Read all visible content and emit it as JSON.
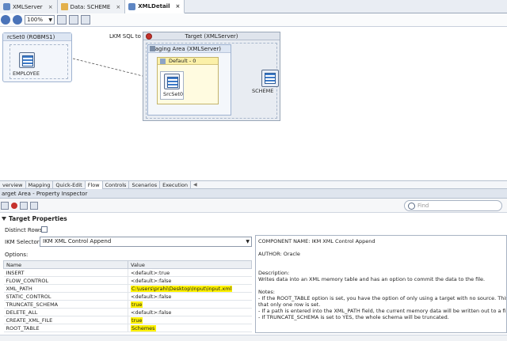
{
  "tabs": [
    {
      "label": "XMLServer",
      "active": false
    },
    {
      "label": "Data: SCHEME",
      "active": false
    },
    {
      "label": "XMLDetail",
      "active": true
    }
  ],
  "toolbar": {
    "zoom": "100%"
  },
  "canvas": {
    "source_set": "rcSet0 (ROBMS1)",
    "source_table": "EMPLOYEE",
    "lkm_label": "LKM SQL to SQ",
    "target_title": "Target (XMLServer)",
    "staging_title": "taging Area (XMLServer)",
    "default_title": "Default - 0",
    "srcset_label": "SrcSet0",
    "target_table": "SCHEME"
  },
  "editor_tabs": [
    "verview",
    "Mapping",
    "Quick-Edit",
    "Flow",
    "Controls",
    "Scenarios",
    "Execution"
  ],
  "active_editor_tab": "Flow",
  "inspector": {
    "title": "arget Area - Property Inspector",
    "find_placeholder": "Find",
    "section": "Target Properties",
    "distinct_rows_label": "Distinct Rows:",
    "ikm_label": "IKM Selector:",
    "ikm_value": "IKM XML Control Append",
    "options_label": "Options:",
    "columns": [
      "Name",
      "Value"
    ],
    "options": [
      {
        "name": "INSERT",
        "value": "<default>:true",
        "highlight": false
      },
      {
        "name": "FLOW_CONTROL",
        "value": "<default>:false",
        "highlight": false
      },
      {
        "name": "XML_PATH",
        "value": "C:\\users\\prahi\\Desktop\\Input\\input.xml",
        "highlight": true
      },
      {
        "name": "STATIC_CONTROL",
        "value": "<default>:false",
        "highlight": false
      },
      {
        "name": "TRUNCATE_SCHEMA",
        "value": "true",
        "highlight": true
      },
      {
        "name": "DELETE_ALL",
        "value": "<default>:false",
        "highlight": false
      },
      {
        "name": "CREATE_XML_FILE",
        "value": "true",
        "highlight": true
      },
      {
        "name": "ROOT_TABLE",
        "value": "Schemes",
        "highlight": true
      }
    ],
    "description": {
      "component": "COMPONENT NAME: IKM XML Control Append",
      "author": "AUTHOR: Oracle",
      "desc_title": "Description:",
      "desc_text": "Writes data into an XML memory table and has an option to commit the data to the file.",
      "notes_title": "Notes:",
      "note1": "- If the ROOT_TABLE option is set, you have the option of only using a target with no source.  This will en",
      "note1b": "that only one row is set.",
      "note2": "- If a path is entered into the XML_PATH field, the current memory data will be written out to a file.",
      "note3": "- If TRUNCATE_SCHEMA is set to YES, the whole schema will be truncated."
    }
  }
}
